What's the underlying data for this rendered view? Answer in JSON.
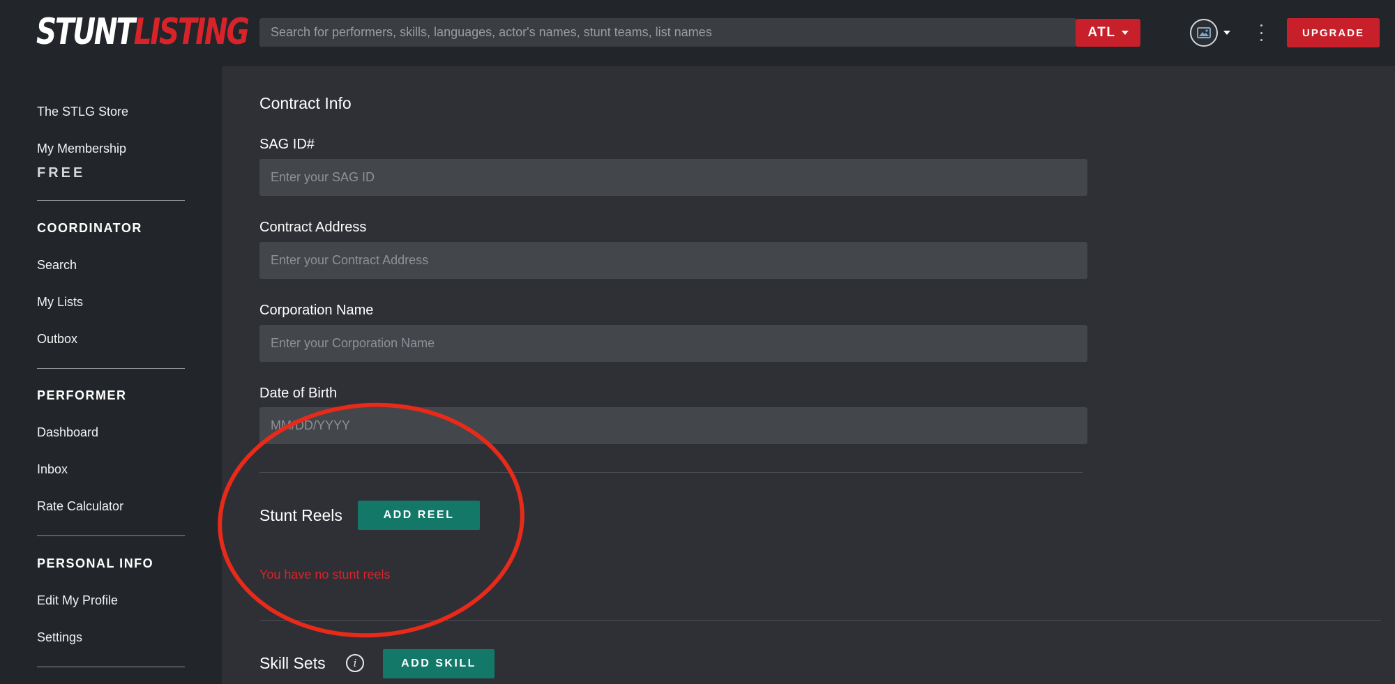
{
  "header": {
    "logo_part1": "STUNT",
    "logo_part2": "LISTING",
    "search_placeholder": "Search for performers, skills, languages, actor's names, stunt teams, list names",
    "location_label": "ATL",
    "upgrade_label": "UPGRADE"
  },
  "sidebar": {
    "store_label": "The STLG Store",
    "membership_label": "My Membership",
    "membership_tier": "FREE",
    "sections": [
      {
        "heading": "COORDINATOR",
        "items": [
          "Search",
          "My Lists",
          "Outbox"
        ]
      },
      {
        "heading": "PERFORMER",
        "items": [
          "Dashboard",
          "Inbox",
          "Rate Calculator"
        ]
      },
      {
        "heading": "PERSONAL INFO",
        "items": [
          "Edit My Profile",
          "Settings"
        ]
      }
    ]
  },
  "main": {
    "contract_title": "Contract Info",
    "fields": [
      {
        "label": "SAG ID#",
        "placeholder": "Enter your SAG ID",
        "value": ""
      },
      {
        "label": "Contract Address",
        "placeholder": "Enter your Contract Address",
        "value": ""
      },
      {
        "label": "Corporation Name",
        "placeholder": "Enter your Corporation Name",
        "value": ""
      },
      {
        "label": "Date of Birth",
        "placeholder": "MM/DD/YYYY",
        "value": ""
      }
    ],
    "reels_title": "Stunt Reels",
    "add_reel_label": "ADD REEL",
    "no_reels_message": "You have no stunt reels",
    "skills_title": "Skill Sets",
    "add_skill_label": "ADD SKILL"
  },
  "colors": {
    "brand_red": "#c8202a",
    "teal_button": "#137868",
    "sidebar_bg": "#222529",
    "main_bg": "#2e3035",
    "annotation_red": "#e82a1a"
  },
  "icons": [
    "image-icon",
    "chevron-down-icon",
    "more-vertical-icon",
    "info-icon"
  ]
}
